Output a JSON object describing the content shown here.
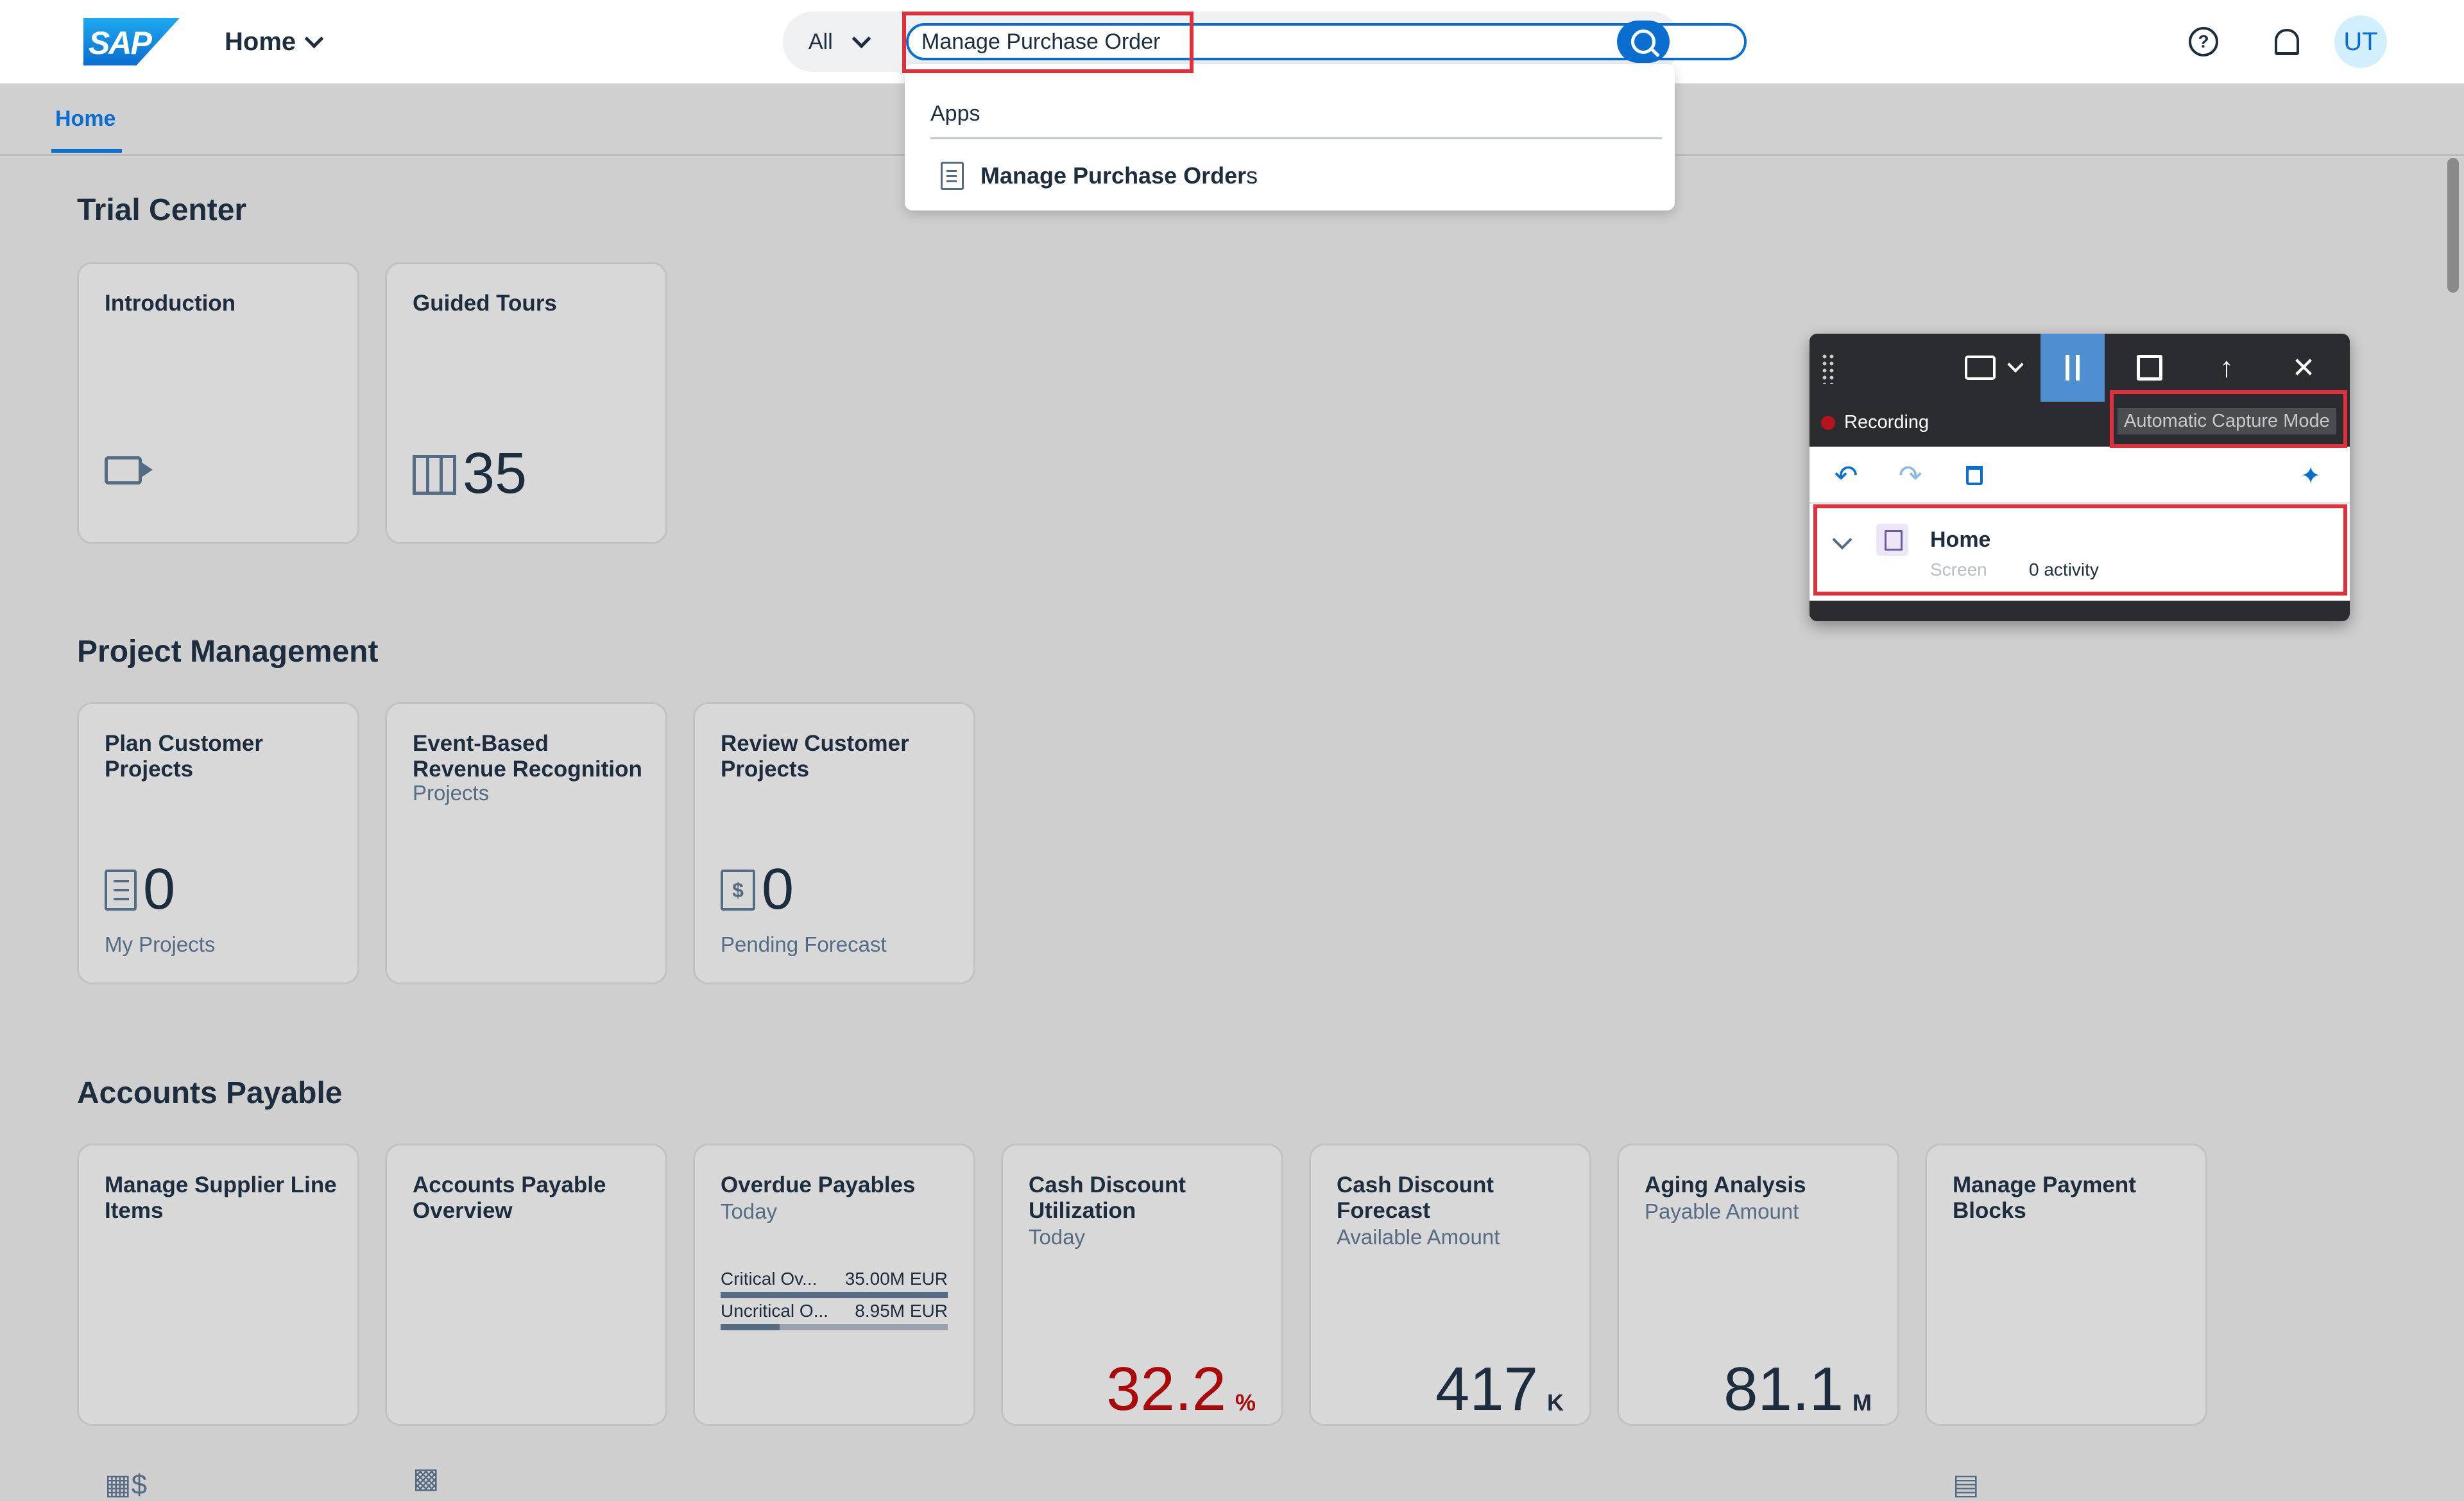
{
  "shell": {
    "logo_text": "SAP",
    "home_menu_label": "Home",
    "search_scope": "All",
    "search_value": "Manage Purchase Order",
    "avatar_initials": "UT"
  },
  "suggestions": {
    "header": "Apps",
    "items": [
      {
        "bold": "Manage Purchase Order",
        "rest": "s"
      }
    ]
  },
  "tabs": {
    "active": "Home"
  },
  "sections": {
    "trial": {
      "title": "Trial Center",
      "tiles": [
        {
          "title": "Introduction"
        },
        {
          "title": "Guided Tours",
          "number": "35"
        }
      ]
    },
    "project": {
      "title": "Project Management",
      "tiles": [
        {
          "title": "Plan Customer Projects",
          "number": "0",
          "footer": "My Projects"
        },
        {
          "title": "Event-Based Revenue Recognition",
          "subtitle": "Projects"
        },
        {
          "title": "Review Customer Projects",
          "number": "0",
          "footer": "Pending Forecast"
        }
      ]
    },
    "ap": {
      "title": "Accounts Payable",
      "tiles": [
        {
          "title": "Manage Supplier Line Items"
        },
        {
          "title": "Accounts Payable Overview"
        },
        {
          "title": "Overdue Payables",
          "subtitle": "Today",
          "rows": [
            {
              "label": "Critical Ov...",
              "value": "35.00M EUR",
              "fill": 1.0
            },
            {
              "label": "Uncritical O...",
              "value": "8.95M EUR",
              "fill": 0.26
            }
          ]
        },
        {
          "title": "Cash Discount Utilization",
          "subtitle": "Today",
          "number": "32.2",
          "unit": "%"
        },
        {
          "title": "Cash Discount Forecast",
          "subtitle": "Available Amount",
          "number": "417",
          "unit": "K"
        },
        {
          "title": "Aging Analysis",
          "subtitle": "Payable Amount",
          "number": "81.1",
          "unit": "M"
        },
        {
          "title": "Manage Payment Blocks"
        }
      ]
    }
  },
  "recorder": {
    "status": "Recording",
    "capture_mode": "Automatic Capture Mode",
    "steps": [
      {
        "name": "Home",
        "kind": "Screen",
        "activity": "0 activity"
      }
    ]
  },
  "colors": {
    "accent": "#0a6ed1",
    "highlight": "#e0303c",
    "negative_kpi": "#aa0808"
  }
}
